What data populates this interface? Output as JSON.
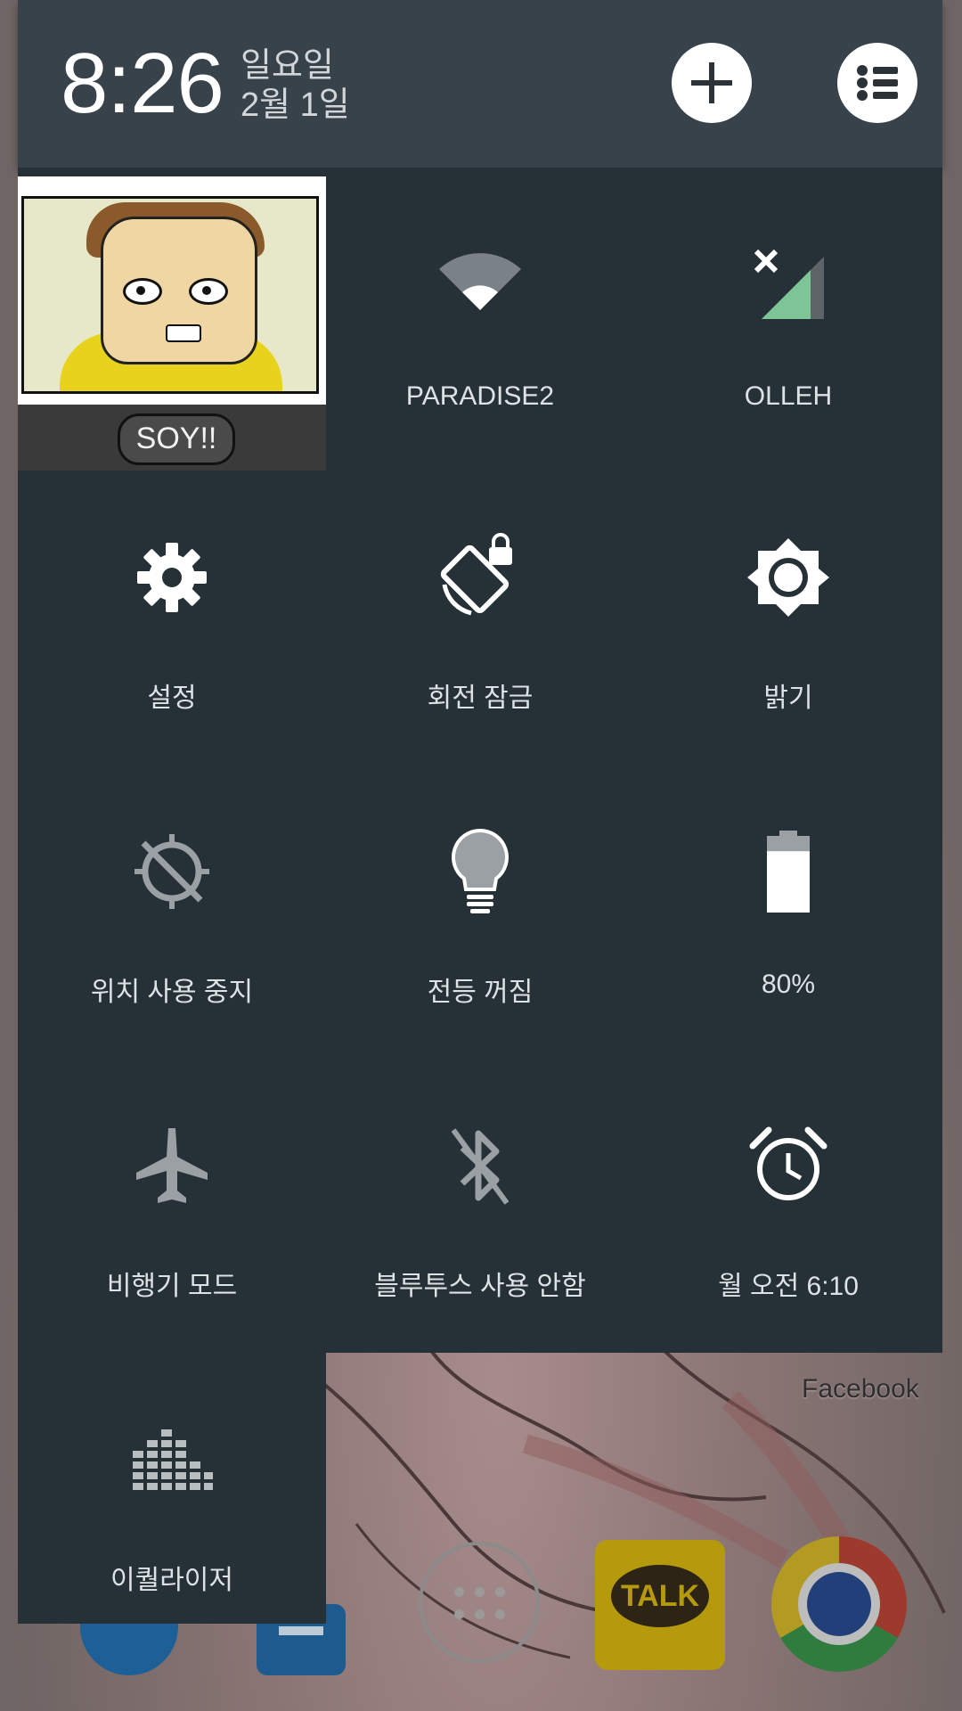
{
  "header": {
    "time": "8:26",
    "day": "일요일",
    "date": "2월 1일",
    "add_user_icon": "plus-icon",
    "settings_list_icon": "list-icon"
  },
  "notification": {
    "caption": "SOY!!"
  },
  "tiles": [
    {
      "label": "PARADISE2",
      "icon": "wifi-icon"
    },
    {
      "label": "OLLEH",
      "icon": "cell-signal-icon"
    },
    {
      "label": "설정",
      "icon": "gear-icon"
    },
    {
      "label": "회전 잠금",
      "icon": "rotation-lock-icon"
    },
    {
      "label": "밝기",
      "icon": "brightness-icon"
    },
    {
      "label": "위치 사용 중지",
      "icon": "location-off-icon"
    },
    {
      "label": "전등 꺼짐",
      "icon": "lightbulb-icon"
    },
    {
      "label": "80%",
      "icon": "battery-icon"
    },
    {
      "label": "비행기 모드",
      "icon": "airplane-icon"
    },
    {
      "label": "블루투스 사용 안함",
      "icon": "bluetooth-off-icon"
    },
    {
      "label": "월 오전 6:10",
      "icon": "alarm-icon"
    },
    {
      "label": "이퀄라이저",
      "icon": "equalizer-icon"
    }
  ],
  "battery_level": 0.8,
  "home": {
    "facebook_label": "Facebook",
    "talk_label": "TALK"
  },
  "colors": {
    "panel_bg": "#263137",
    "header_bg": "#38424a",
    "signal_accent": "#7dc497"
  }
}
